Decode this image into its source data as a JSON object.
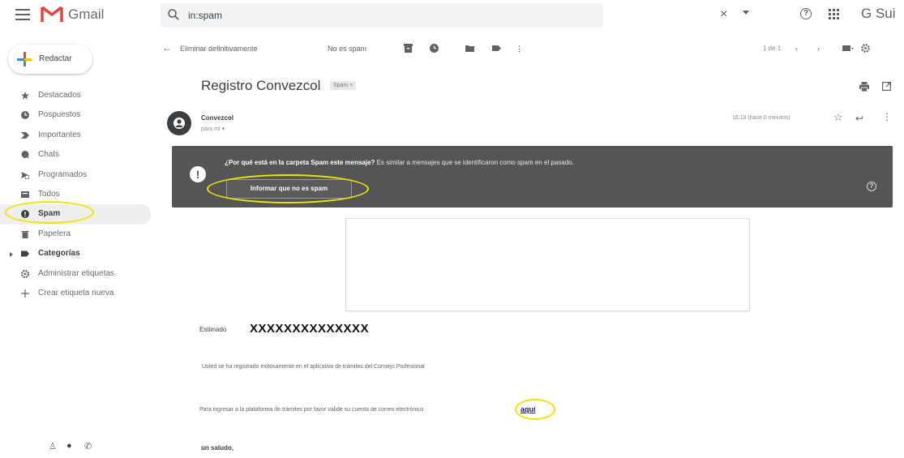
{
  "app": {
    "brand": "Gmail",
    "suite_label": "G Sui",
    "accent_color": "#ea4335",
    "annotation_color": "#f2e400",
    "banner_color": "#555555"
  },
  "search": {
    "value": "in:spam",
    "clear_label": "×"
  },
  "compose": {
    "label": "Redactar"
  },
  "sidebar": {
    "items": [
      {
        "label": "Destacados",
        "icon": "star-icon"
      },
      {
        "label": "Pospuestos",
        "icon": "clock-icon"
      },
      {
        "label": "Importantes",
        "icon": "important-icon"
      },
      {
        "label": "Chats",
        "icon": "chat-icon"
      },
      {
        "label": "Programados",
        "icon": "scheduled-icon"
      },
      {
        "label": "Todos",
        "icon": "all-mail-icon"
      },
      {
        "label": "Spam",
        "icon": "spam-icon"
      },
      {
        "label": "Papelera",
        "icon": "trash-icon"
      },
      {
        "label": "Categorías",
        "icon": "label-icon"
      },
      {
        "label": "Administrar etiquetas",
        "icon": "gear-icon"
      },
      {
        "label": "Crear etiqueta nueva",
        "icon": "plus-icon"
      }
    ]
  },
  "toolbar": {
    "delete_forever": "Eliminar definitivamente",
    "not_spam": "No es spam",
    "pager": "1 de 1"
  },
  "message": {
    "subject": "Registro Convezcol",
    "tag": "Spam ×",
    "sender": "Convezcol",
    "to": "para mí ▾",
    "time": "16:19 (hace 0 minutos)"
  },
  "warning": {
    "question": "¿Por qué está en la carpeta Spam este mensaje?",
    "explanation": " Es similar a mensajes que se identificaron como spam en el pasado.",
    "report_button": "Informar que no es spam"
  },
  "body": {
    "greeting_label": "Estimado",
    "greeting_name": "XXXXXXXXXXXXXX",
    "paragraph1": "Usted se ha registrado exitosamente en el aplicativo de trámites del Consejo Profesional",
    "paragraph2": "Para ingresar a la plataforma de trámites por favor valide su cuenta de correo electrónico",
    "link_text": "aquí",
    "closing": "un saludo,"
  }
}
